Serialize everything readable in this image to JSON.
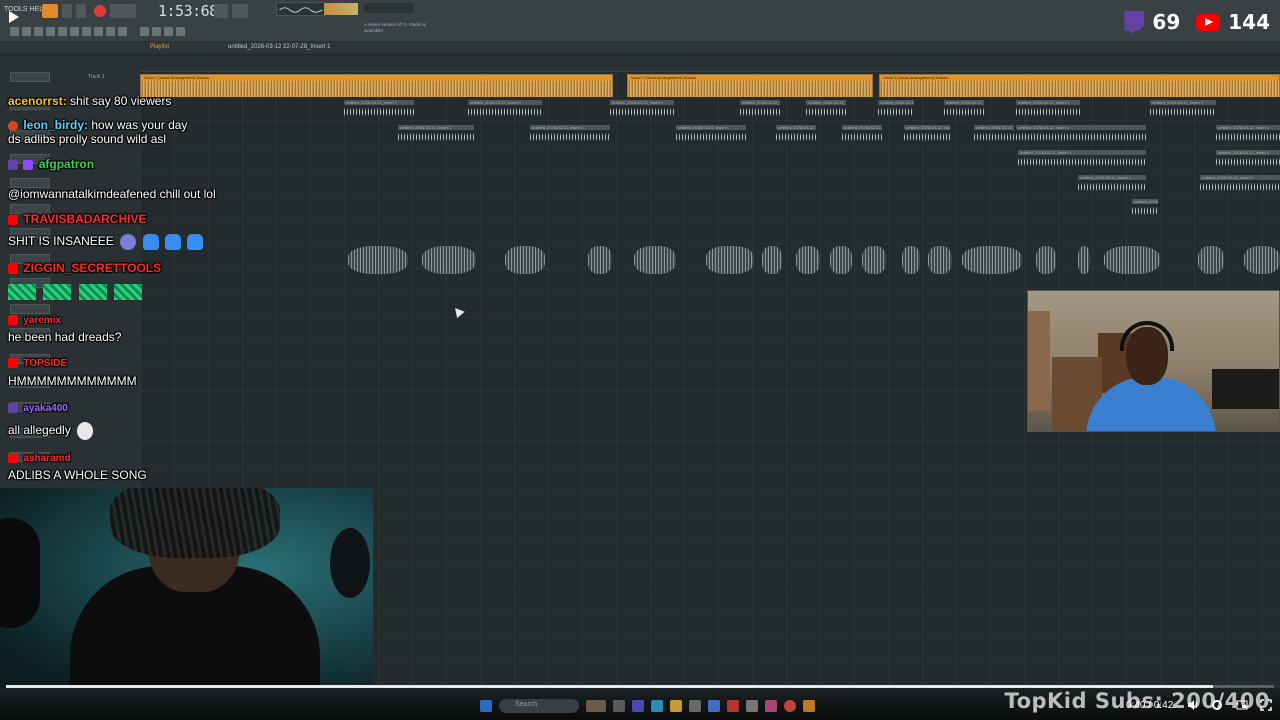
{
  "daw": {
    "menu": "TOOLS  HELP",
    "timer": "1:53:68",
    "playlist_title": "Playlist",
    "project_name": "untitled_2026-03-12 22-07-28_Insert 1",
    "news_text": "A newer version of FL Studio is available!",
    "track_label": "Track 1",
    "arrange_label": "Arrangement"
  },
  "stream": {
    "twitch_viewers": "69",
    "youtube_viewers": "144",
    "subs_goal": "TopKid Subs: 200/400"
  },
  "chat": [
    {
      "user": "acenorrst:",
      "user_color": "#f4c430",
      "text": "shit say 80 viewers",
      "platform": "twitch"
    },
    {
      "user": "leon_birdy:",
      "user_color": "#5fd3ff",
      "text": "how was your day",
      "platform": "twitch"
    },
    {
      "user": "",
      "user_color": "#fff",
      "text": "ds adlibs prolly sound wild asl",
      "platform": "twitch"
    },
    {
      "user": "afgpatron",
      "user_color": "#39d353",
      "text": "",
      "platform": "twitch"
    },
    {
      "user": "",
      "user_color": "#aaa",
      "text": "@iomwannatalkimdeafened chill out lol",
      "platform": "twitch"
    },
    {
      "user": "TRAVISBADARCHIVE",
      "user_color": "#ff2a2a",
      "text": "",
      "platform": "youtube"
    },
    {
      "user": "",
      "user_color": "#fff",
      "text": "SHIT IS INSANEEE",
      "platform": "youtube"
    },
    {
      "user": "ZIGGIN_SECRETTOOLS",
      "user_color": "#ff2a2a",
      "text": "",
      "platform": "youtube"
    },
    {
      "user": "yaremix",
      "user_color": "#ff2a2a",
      "text": "he been had dreads?",
      "platform": "youtube"
    },
    {
      "user": "TOPSIDE",
      "user_color": "#ff2a2a",
      "text": "HMMMMMMMMMMMM",
      "platform": "youtube"
    },
    {
      "user": "ayaka400",
      "user_color": "#a06bff",
      "text": "all allegedly",
      "platform": "twitch"
    },
    {
      "user": "asharamd",
      "user_color": "#ff2a2a",
      "text": "ADLIBS A WHOLE SONG",
      "platform": "youtube"
    }
  ],
  "player": {
    "time": "0:40 / 0:42",
    "progress": 0.952
  },
  "taskbar": {
    "search_placeholder": "Search"
  },
  "clips": {
    "top": "Vocal 1 (Vocal-Arrangement) #tracks",
    "grey": "untitled_2026-03-12_Insert 1"
  }
}
